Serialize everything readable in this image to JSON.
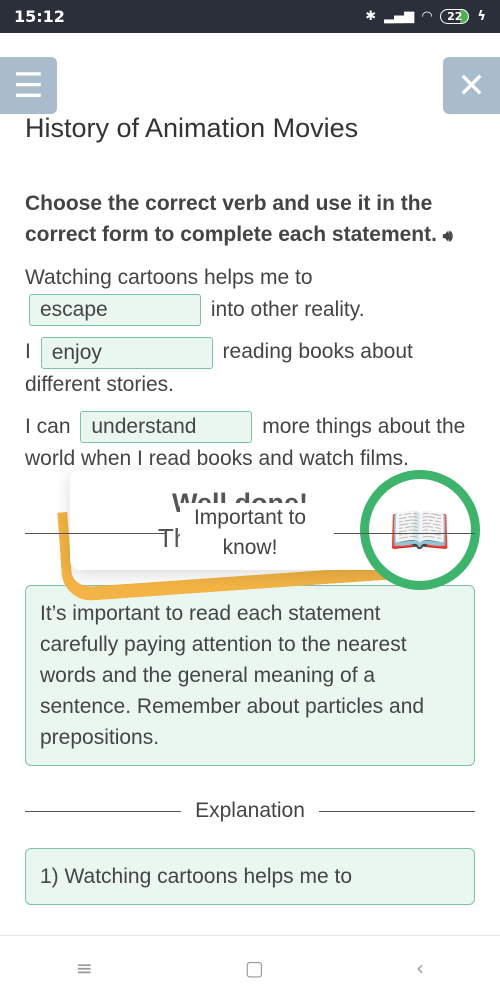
{
  "status": {
    "time": "15:12",
    "battery": "22",
    "icons": [
      "bluetooth-icon",
      "signal-icon",
      "wifi-icon",
      "battery-icon",
      "charging-icon"
    ]
  },
  "header": {
    "title": "History of Animation Movies"
  },
  "task": {
    "instruction": "Choose the correct verb and use it in the correct form to complete each statement.",
    "s1": {
      "pre": "Watching cartoons helps me to",
      "answer": "escape",
      "post": "into other reality."
    },
    "s2": {
      "pre": "I",
      "answer": "enjoy",
      "post": "reading books about different stories."
    },
    "s3": {
      "pre": "I can",
      "answer": "understand",
      "post": "more things about the world when I read books and watch films."
    }
  },
  "feedback": {
    "title": "Well done!",
    "subtitle": "That’s correct!"
  },
  "important": {
    "heading": "Important to know!",
    "text": "It’s important to read each statement carefully paying attention to the nearest words and the general meaning of a sentence. Remember about particles and prepositions."
  },
  "explanation": {
    "heading": "Explanation",
    "first": "1) Watching cartoons helps me to"
  },
  "colors": {
    "accent": "#3db36b",
    "field_border": "#7cc2a5",
    "orange": "#f4b445",
    "button": "#a8bccb"
  }
}
